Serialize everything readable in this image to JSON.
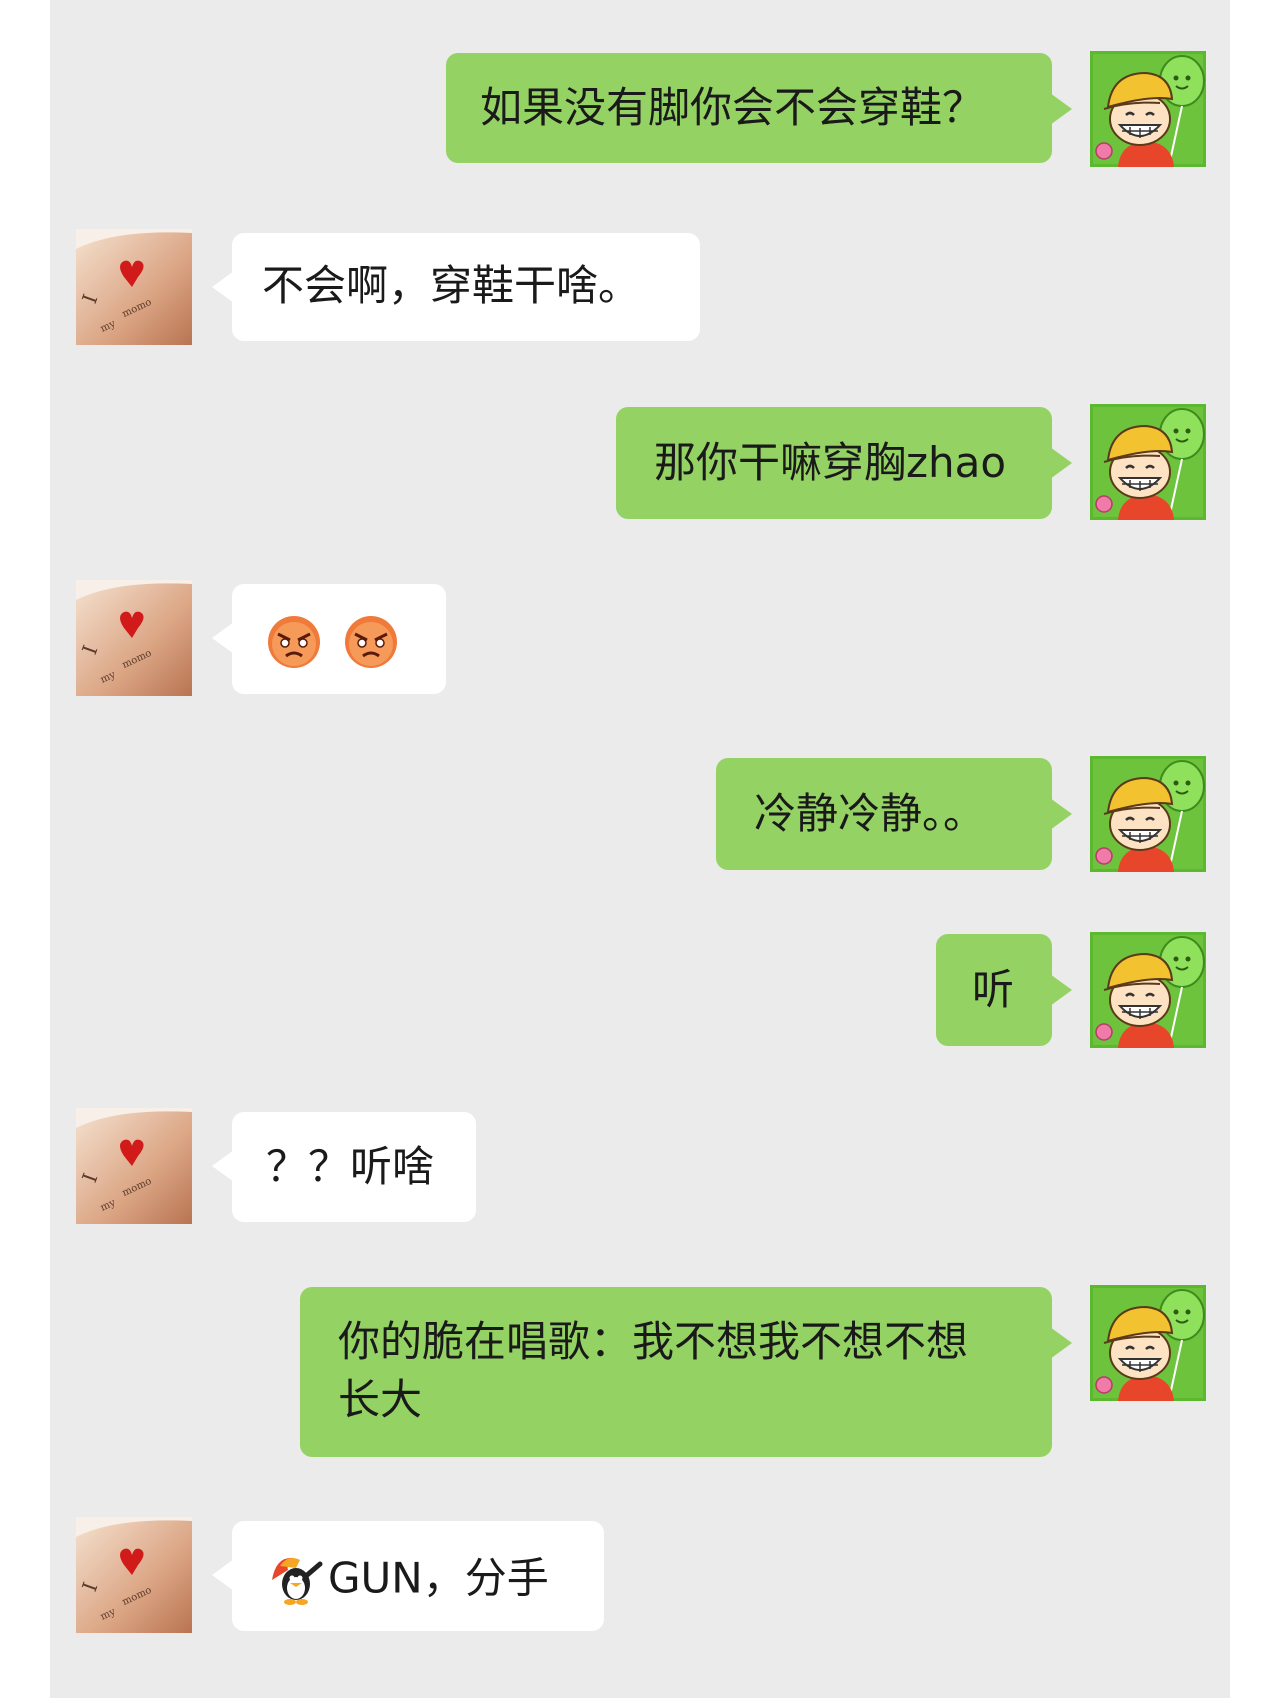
{
  "conversation": {
    "messages": [
      {
        "side": "me",
        "text": "如果没有脚你会不会穿鞋？"
      },
      {
        "side": "them",
        "text": "不会啊，穿鞋干啥。"
      },
      {
        "side": "me",
        "text": "那你干嘛穿胸zhao"
      },
      {
        "side": "them",
        "text": "",
        "emoji": [
          "angry-face-icon",
          "angry-face-icon"
        ]
      },
      {
        "side": "me",
        "text": "冷静冷静。。"
      },
      {
        "side": "me",
        "text": "听"
      },
      {
        "side": "them",
        "text": "？？听啥"
      },
      {
        "side": "me",
        "text": "你的脆在唱歌：我不想我不想不想长大",
        "lines": [
          "你的脆在唱歌：我不想我不想不想",
          "长大"
        ]
      },
      {
        "side": "them",
        "text": "GUN，分手",
        "icon": "angry-penguin-icon"
      }
    ]
  },
  "colors": {
    "background": "#ebebeb",
    "my_bubble": "#95d264",
    "their_bubble": "#ffffff"
  }
}
